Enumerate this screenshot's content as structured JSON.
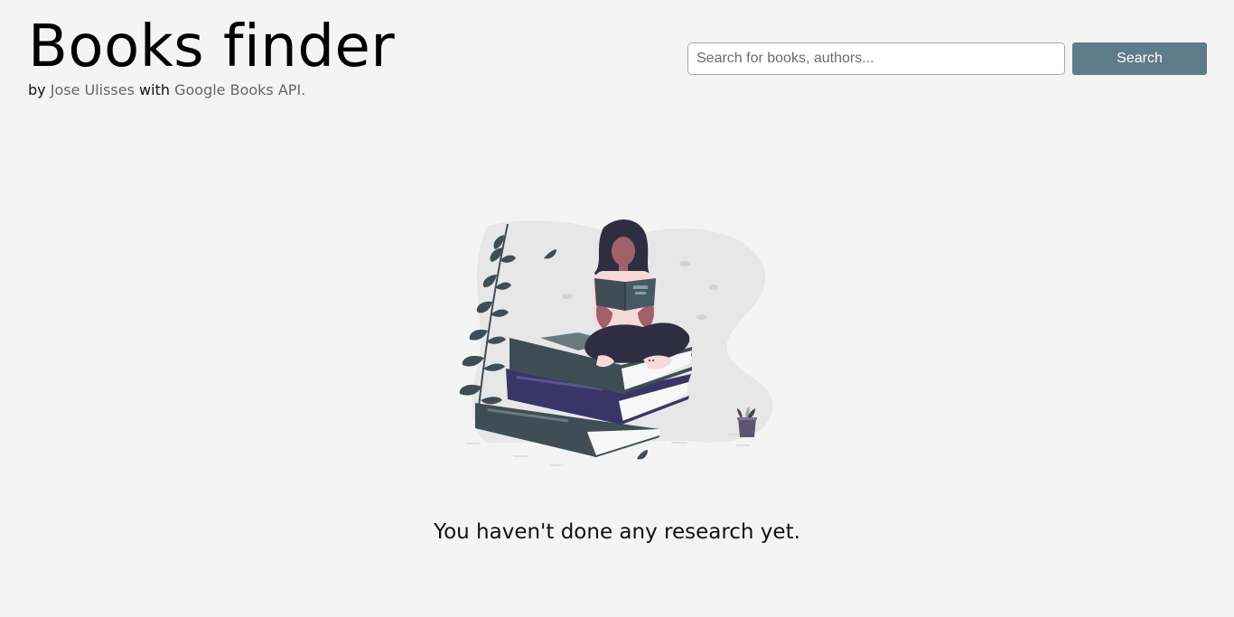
{
  "header": {
    "title": "Books finder",
    "subtitle": {
      "by": "by",
      "author": "Jose Ulisses",
      "with": "with",
      "api": "Google Books API",
      "end": "."
    }
  },
  "search": {
    "placeholder": "Search for books, authors...",
    "value": "",
    "button_label": "Search"
  },
  "empty_state": {
    "illustration": "woman-reading-on-book-stack-illustration",
    "message": "You haven't done any research yet."
  },
  "colors": {
    "background": "#f4f4f4",
    "button": "#5f7c8a",
    "link": "#666666",
    "book_dark": "#3f4d54",
    "book_purple": "#3a3566"
  }
}
